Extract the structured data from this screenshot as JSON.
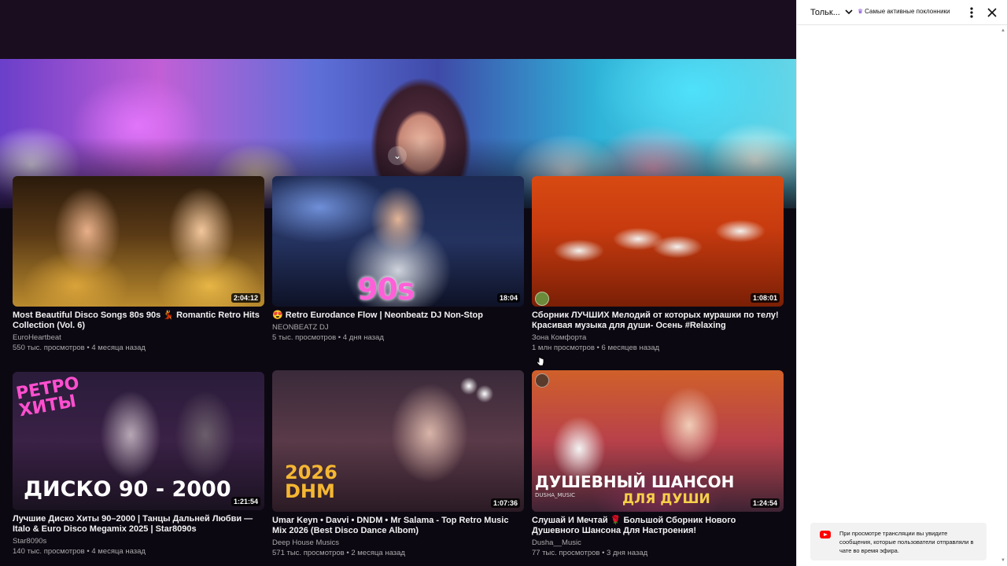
{
  "chat": {
    "mode_label": "Тольк...",
    "fans_label": "Самые активные поклонники",
    "notice_text": "При просмотре трансляции вы увидите сообщения, которые пользователи отправляли в чате во время эфира."
  },
  "videos": [
    {
      "title": "Most Beautiful Disco Songs 80s 90s 💃 Romantic Retro Hits Collection (Vol. 6)",
      "channel": "EuroHeartbeat",
      "meta": "550 тыс. просмотров • 4 месяца назад",
      "duration": "2:04:12"
    },
    {
      "title": "😍 Retro Eurodance Flow | Neonbeatz DJ Non-Stop",
      "channel": "NEONBEATZ DJ",
      "meta": "5 тыс. просмотров • 4 дня назад",
      "duration": "18:04",
      "thumb_text": "90s"
    },
    {
      "title": "Сборник ЛУЧШИХ Мелодий от которых мурашки по телу! Красивая музыка для души- Осень #Relaxing",
      "channel": "Зона Комфорта",
      "meta": "1 млн просмотров • 6 месяцев назад",
      "duration": "1:08:01"
    },
    {
      "title": "Лучшие Диско Хиты 90–2000 | Танцы Дальней Любви — Italo & Euro Disco Megamix 2025 | Star8090s",
      "channel": "Star8090s",
      "meta": "140 тыс. просмотров • 4 месяца назад",
      "duration": "1:21:54",
      "thumb_text": "ДИСКО 90 - 2000",
      "thumb_text_top": "РЕТРО ХИТЫ"
    },
    {
      "title": "Umar Keyn • Davvi • DNDM • Mr Salama - Top Retro Music Mix 2026 (Best Disco Dance Albom)",
      "channel": "Deep House Musics",
      "meta": "571 тыс. просмотров • 2 месяца назад",
      "duration": "1:07:36",
      "thumb_text": "2026",
      "thumb_text_2": "DHM"
    },
    {
      "title": "Слушай И Мечтай 🌹 Большой Сборник Нового Душевного Шансона Для Настроения!",
      "channel": "Dusha__Music",
      "meta": "77 тыс. просмотров • 3 дня назад",
      "duration": "1:24:54",
      "thumb_text": "ДУШЕВНЫЙ ШАНСОН",
      "thumb_text_2": "ДЛЯ ДУШИ",
      "thumb_text_small": "DUSHA_MUSIC"
    }
  ],
  "icons": {
    "collapse": "chevron-down-icon",
    "chat_dropdown": "chevron-down-icon",
    "fans": "crown-icon",
    "menu": "more-vert-icon",
    "close": "close-icon",
    "notice": "youtube-icon"
  },
  "colors": {
    "accent_red": "#ff0000",
    "crown_purple": "#7b3fd1"
  }
}
